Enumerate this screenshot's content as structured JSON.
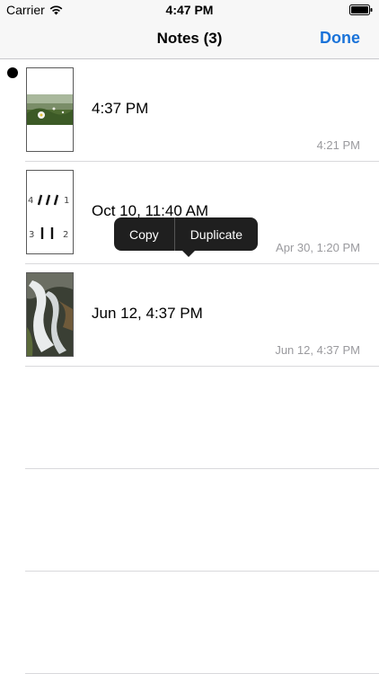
{
  "status": {
    "carrier": "Carrier",
    "time": "4:47 PM"
  },
  "nav": {
    "title": "Notes (3)",
    "done_label": "Done"
  },
  "notes": [
    {
      "title": "4:37 PM",
      "subtitle": "4:21 PM",
      "thumbnail": "flower-photo",
      "selected": true
    },
    {
      "title": "Oct 10, 11:40 AM",
      "subtitle": "Apr 30, 1:20 PM",
      "thumbnail": "handwritten-tally",
      "selected": false
    },
    {
      "title": "Jun 12, 4:37 PM",
      "subtitle": "Jun 12, 4:37 PM",
      "thumbnail": "waterfall-photo",
      "selected": false
    }
  ],
  "tally": {
    "a": "4",
    "b": "1",
    "c": "3",
    "d": "2"
  },
  "context_menu": {
    "copy_label": "Copy",
    "duplicate_label": "Duplicate"
  },
  "colors": {
    "accent": "#1a73d9",
    "subtitle": "#9a9a9e",
    "menu_bg": "#1f1f1f"
  }
}
